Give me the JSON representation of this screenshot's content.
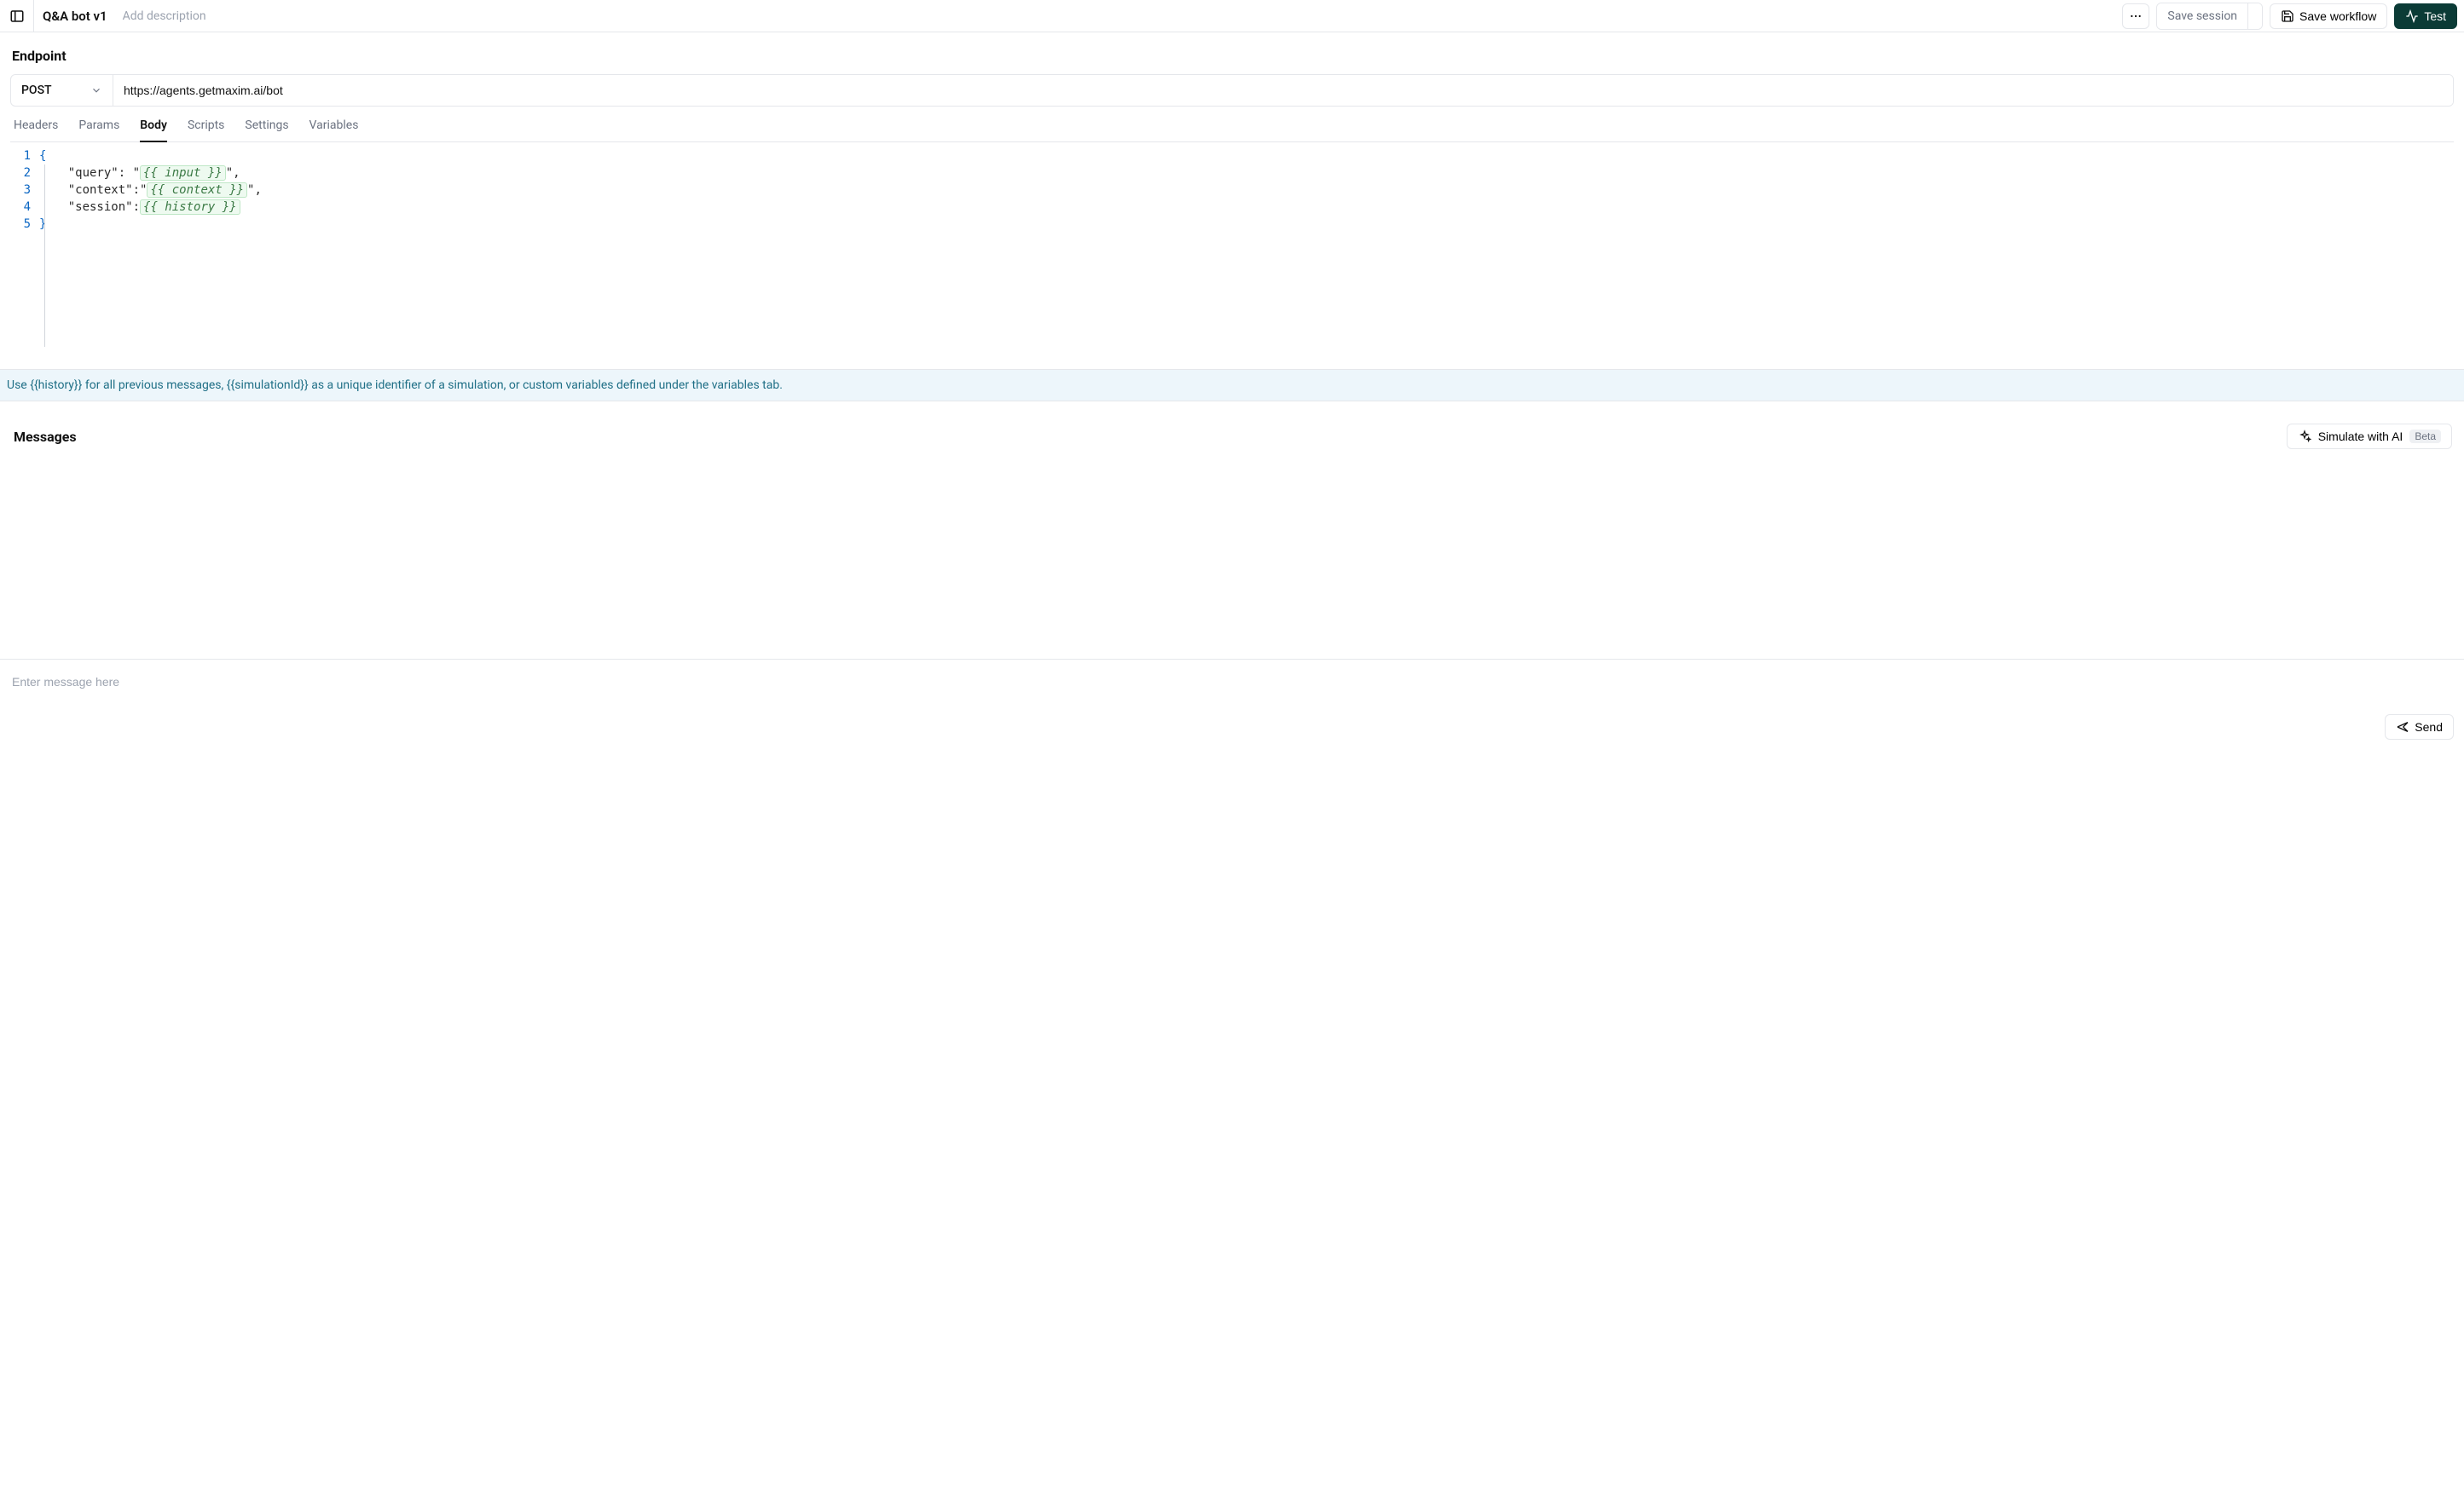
{
  "header": {
    "title": "Q&A bot v1",
    "add_description": "Add description",
    "save_session": "Save session",
    "save_workflow": "Save workflow",
    "test": "Test"
  },
  "endpoint": {
    "section_title": "Endpoint",
    "method": "POST",
    "url": "https://agents.getmaxim.ai/bot"
  },
  "tabs": [
    {
      "id": "headers",
      "label": "Headers",
      "active": false
    },
    {
      "id": "params",
      "label": "Params",
      "active": false
    },
    {
      "id": "body",
      "label": "Body",
      "active": true
    },
    {
      "id": "scripts",
      "label": "Scripts",
      "active": false
    },
    {
      "id": "settings",
      "label": "Settings",
      "active": false
    },
    {
      "id": "variables",
      "label": "Variables",
      "active": false
    }
  ],
  "body_editor": {
    "line_numbers": [
      "1",
      "2",
      "3",
      "4",
      "5"
    ],
    "lines": {
      "l1_open": "{",
      "l2_pre": "    \"query\": \"",
      "l2_tpl": "{{ input }}",
      "l2_post": "\",",
      "l3_pre": "    \"context\":\"",
      "l3_tpl": "{{ context }}",
      "l3_post": "\",",
      "l4_pre": "    \"session\":",
      "l4_tpl": "{{ history }}",
      "l5_close": "}"
    }
  },
  "info_banner": "Use {{history}} for all previous messages, {{simulationId}} as a unique identifier of a simulation, or custom variables defined under the variables tab.",
  "messages": {
    "title": "Messages",
    "simulate_label": "Simulate with AI",
    "beta": "Beta"
  },
  "composer": {
    "placeholder": "Enter message here",
    "send": "Send"
  }
}
